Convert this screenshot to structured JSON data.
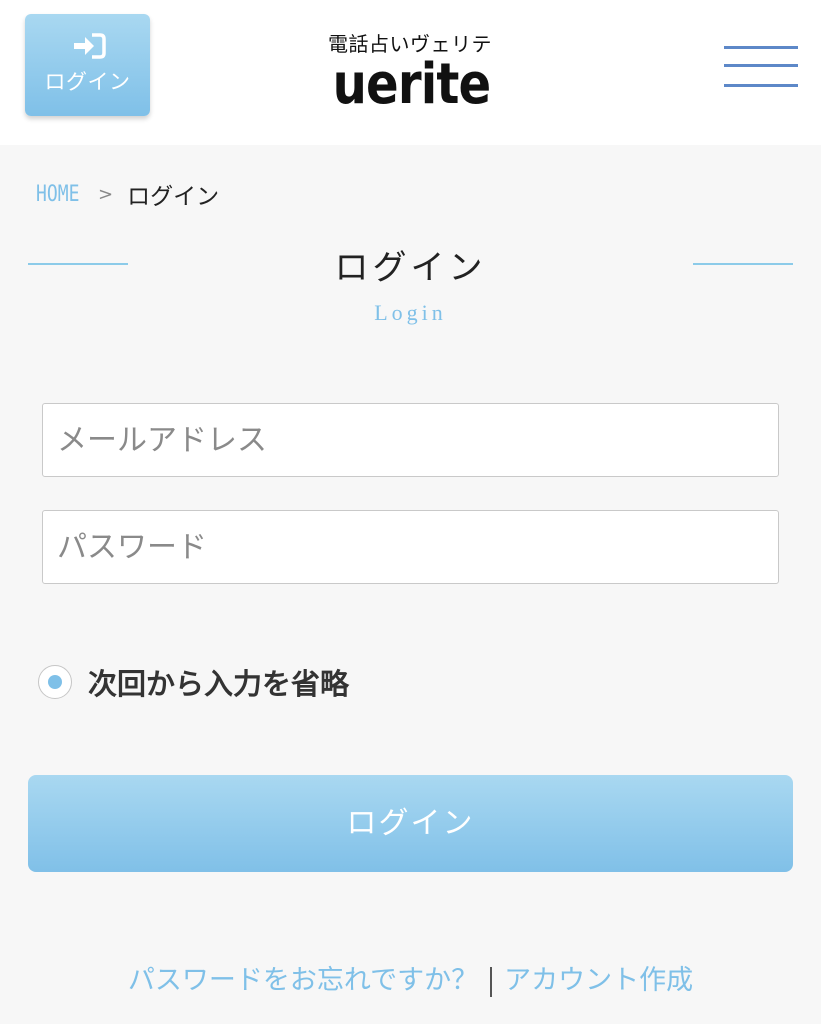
{
  "header": {
    "login_button_label": "ログイン",
    "logo_sub": "電話占いヴェリテ",
    "logo_main": "uerite"
  },
  "breadcrumb": {
    "home": "HOME",
    "separator": ">",
    "current": "ログイン"
  },
  "page": {
    "title": "ログイン",
    "subtitle": "Login"
  },
  "form": {
    "email_placeholder": "メールアドレス",
    "password_placeholder": "パスワード",
    "remember_label": "次回から入力を省略",
    "remember_checked": true,
    "submit_label": "ログイン"
  },
  "links": {
    "forgot_password": "パスワードをお忘れですか？",
    "create_account": "アカウント作成"
  },
  "colors": {
    "accent": "#7fc0e8",
    "menu": "#5d88c8"
  },
  "icons": {
    "login": "login-arrow-icon",
    "menu": "hamburger-menu-icon"
  }
}
